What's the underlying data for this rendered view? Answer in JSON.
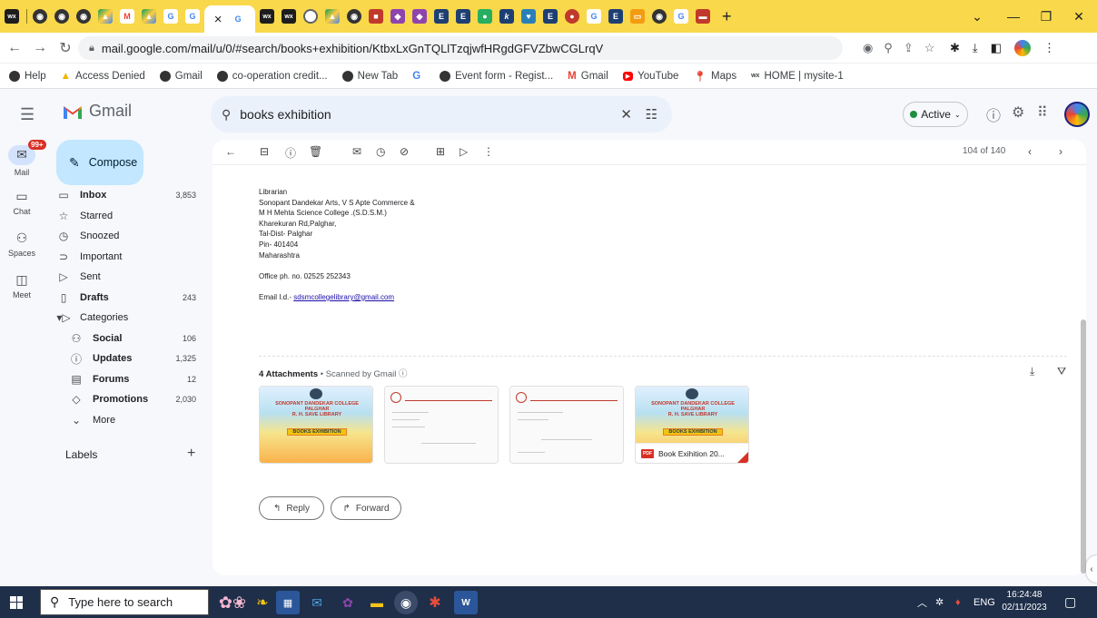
{
  "browser": {
    "new_tab_label": "+",
    "url": "mail.google.com/mail/u/0/#search/books+exhibition/KtbxLxGnTQLlTzqjwfHRgdGFVZbwCGLrqV",
    "tab_close_label": "×"
  },
  "bookmarks": [
    {
      "label": "Help"
    },
    {
      "label": "Access Denied"
    },
    {
      "label": "Gmail"
    },
    {
      "label": "co-operation credit..."
    },
    {
      "label": "New Tab"
    },
    {
      "label": ""
    },
    {
      "label": "Event form - Regist..."
    },
    {
      "label": "Gmail"
    },
    {
      "label": "YouTube"
    },
    {
      "label": "Maps"
    },
    {
      "label": "HOME | mysite-1"
    }
  ],
  "gmail": {
    "product_name": "Gmail",
    "search_value": "books exhibition",
    "status_label": "Active",
    "rail": {
      "mail_badge": "99+",
      "mail": "Mail",
      "chat": "Chat",
      "spaces": "Spaces",
      "meet": "Meet"
    },
    "compose_label": "Compose",
    "nav": [
      {
        "label": "Inbox",
        "count": "3,853"
      },
      {
        "label": "Starred",
        "count": ""
      },
      {
        "label": "Snoozed",
        "count": ""
      },
      {
        "label": "Important",
        "count": ""
      },
      {
        "label": "Sent",
        "count": ""
      },
      {
        "label": "Drafts",
        "count": "243"
      },
      {
        "label": "Categories",
        "count": ""
      },
      {
        "label": "Social",
        "count": "106"
      },
      {
        "label": "Updates",
        "count": "1,325"
      },
      {
        "label": "Forums",
        "count": "12"
      },
      {
        "label": "Promotions",
        "count": "2,030"
      },
      {
        "label": "More",
        "count": ""
      }
    ],
    "labels_heading": "Labels",
    "page_count": "104 of 140"
  },
  "email": {
    "signature": [
      "Librarian",
      "Sonopant Dandekar Arts, V S Apte Commerce &",
      "M H Mehta Science College .(S.D.S.M.)",
      "Kharekuran Rd,Palghar,",
      "Tal-Dist- Palghar",
      "Pin- 401404",
      "Maharashtra"
    ],
    "office_phone": "Office ph. no. 02525 252343",
    "email_prefix": "Email I.d.- ",
    "email_address": "sdsmcollegelibrary@gmail.com",
    "attachments_heading": "4 Attachments",
    "scanned_label": " • Scanned by Gmail ⓘ",
    "attachment_pdf_name": "Book Exihition 20...",
    "attachment_poster_college": "SONOPANT DANDEKAR COLLEGE PALGHAR",
    "attachment_poster_library": "R. H. SAVE LIBRARY",
    "attachment_poster_title": "BOOKS EXHIBITION",
    "reply_label": "Reply",
    "forward_label": "Forward"
  },
  "taskbar": {
    "search_placeholder": "Type here to search",
    "language": "ENG",
    "time": "16:24:48",
    "date": "02/11/2023"
  },
  "colors": {
    "tab_strip": "#f9d84b",
    "compose_bg": "#c2e7ff",
    "taskbar_bg": "#1f2f4a",
    "gmail_bg": "#f6f8fc"
  }
}
